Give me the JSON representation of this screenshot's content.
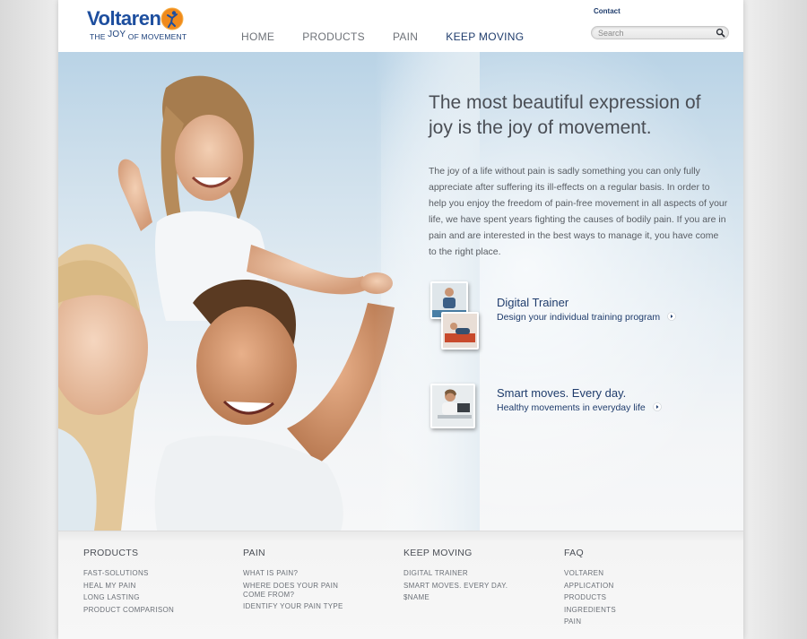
{
  "brand": {
    "name": "Voltaren",
    "tagline_pre": "THE",
    "tagline_joy": "JOY",
    "tagline_post": "OF MOVEMENT"
  },
  "header": {
    "nav": [
      {
        "label": "HOME"
      },
      {
        "label": "PRODUCTS"
      },
      {
        "label": "PAIN"
      },
      {
        "label": "KEEP MOVING"
      }
    ],
    "contact_label": "Contact",
    "search_placeholder": "Search"
  },
  "hero": {
    "title": "The most beautiful expression of joy is the joy of movement.",
    "body": "The joy of a life without pain is sadly something you can only fully appreciate after suffering its ill-effects on a regular basis. In order to help you enjoy the freedom of pain-free movement in all aspects of your life, we have spent years fighting the causes of bodily pain. If you are in pain and are interested in the best ways to manage it, you have come to the right place.",
    "features": [
      {
        "title": "Digital Trainer",
        "link": "Design your individual training program"
      },
      {
        "title": "Smart moves. Every day.",
        "link": "Healthy movements in everyday life"
      }
    ]
  },
  "footer": {
    "columns": [
      {
        "heading": "PRODUCTS",
        "links": [
          "FAST-SOLUTIONS",
          "HEAL MY PAIN",
          "LONG LASTING",
          "PRODUCT COMPARISON"
        ]
      },
      {
        "heading": "PAIN",
        "links": [
          "WHAT IS PAIN?",
          "WHERE DOES YOUR PAIN COME FROM?",
          "IDENTIFY YOUR PAIN TYPE"
        ]
      },
      {
        "heading": "KEEP MOVING",
        "links": [
          "DIGITAL TRAINER",
          "SMART MOVES. EVERY DAY.",
          "$NAME"
        ]
      },
      {
        "heading": "FAQ",
        "links": [
          "VOLTAREN",
          "APPLICATION",
          "PRODUCTS",
          "INGREDIENTS",
          "PAIN"
        ]
      }
    ]
  },
  "colors": {
    "brand_blue": "#1d4e9e",
    "nav_active": "#1f3c6c",
    "logo_orange": "#f08a1c"
  }
}
